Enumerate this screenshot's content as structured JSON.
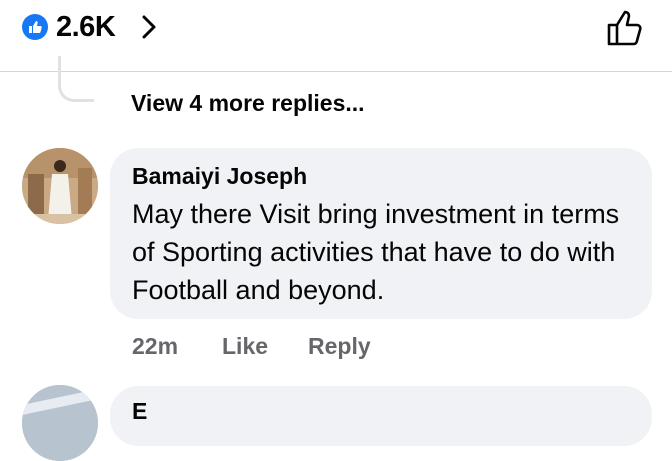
{
  "header": {
    "reaction_count": "2.6K"
  },
  "thread": {
    "view_more_label": "View 4 more replies..."
  },
  "comment": {
    "author": "Bamaiyi Joseph",
    "text": "May there Visit bring investment in terms of Sporting activities that have to do with Football and beyond.",
    "time": "22m",
    "like_label": "Like",
    "reply_label": "Reply"
  },
  "next_comment": {
    "author_partial": "E"
  },
  "colors": {
    "accent": "#1877f2",
    "bubble": "#f0f2f5",
    "meta_text": "#65676b"
  }
}
